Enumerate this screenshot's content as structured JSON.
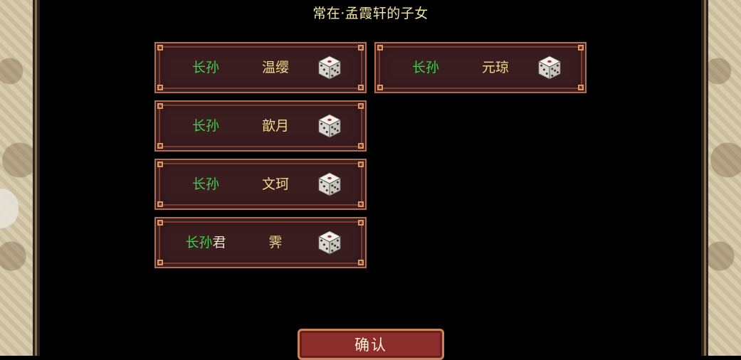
{
  "title": "常在·孟霞轩的子女",
  "children": [
    {
      "relation": "长孙",
      "given": "",
      "name": "温缨"
    },
    {
      "relation": "长孙",
      "given": "",
      "name": "元琼"
    },
    {
      "relation": "长孙",
      "given": "",
      "name": "歆月"
    },
    {
      "relation": "长孙",
      "given": "",
      "name": "文珂"
    },
    {
      "relation": "长孙",
      "given": "君",
      "name": "霁"
    }
  ],
  "dice_icon": "dice-icon",
  "confirm_label": "确认",
  "colors": {
    "relation": "#37d24a",
    "name": "#f3d98a",
    "title": "#f1e6a6",
    "card_bg": "#3a1d1f",
    "card_border": "#b56b4d",
    "confirm_bg": "#8b2d2a"
  }
}
